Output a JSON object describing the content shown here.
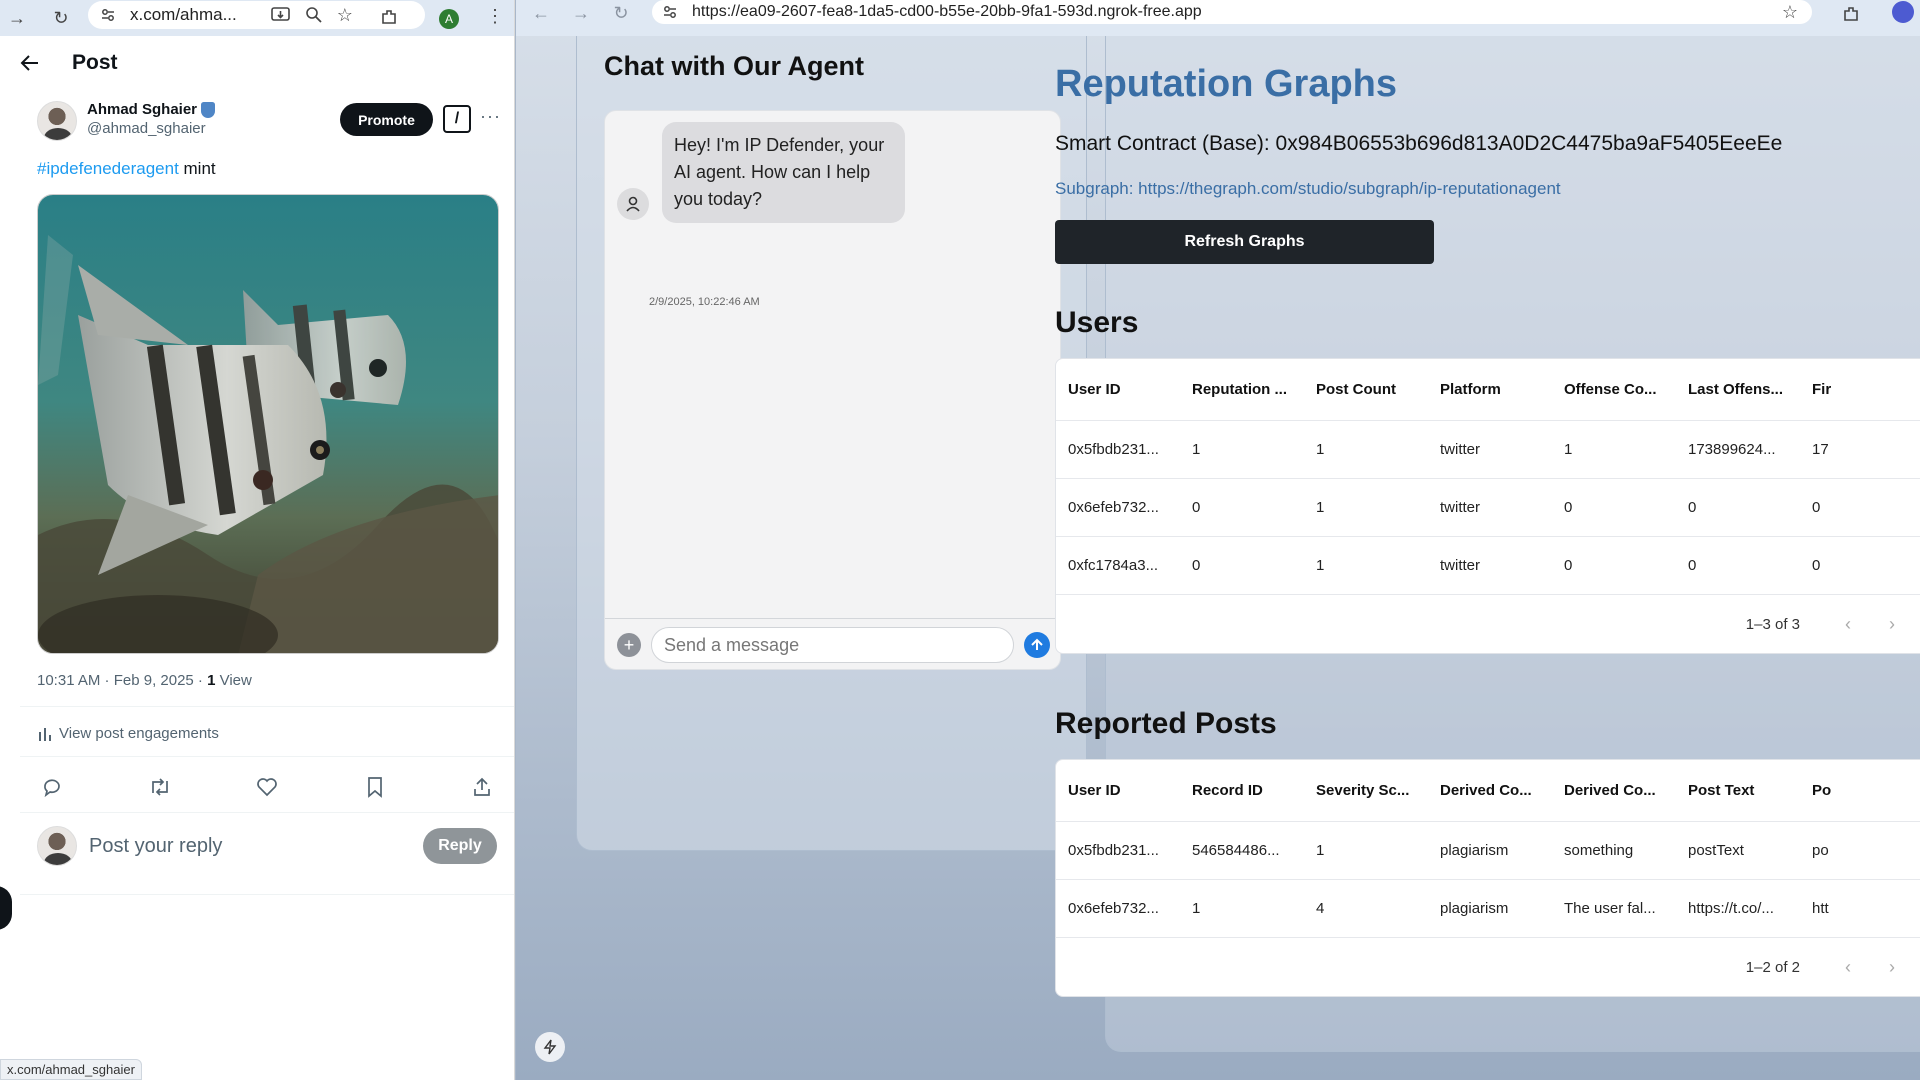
{
  "left": {
    "omnibox_url": "x.com/ahma...",
    "avatar_letter": "A",
    "header_title": "Post",
    "author_name": "Ahmad Sghaier",
    "author_handle": "@ahmad_sghaier",
    "promote_label": "Promote",
    "grok_label": "/",
    "more_label": "···",
    "post_hashtag": "#ipdefenederagent",
    "post_text": " mint",
    "meta_time": "10:31 AM · Feb 9, 2025 · ",
    "meta_views_count": "1",
    "meta_views_label": " View",
    "engagements_label": "View post engagements",
    "reply_placeholder": "Post your reply",
    "reply_label": "Reply",
    "status_url": "x.com/ahmad_sghaier"
  },
  "right": {
    "omnibox_url": "https://ea09-2607-fea8-1da5-cd00-b55e-20bb-9fa1-593d.ngrok-free.app",
    "chat": {
      "title": "Chat with Our Agent",
      "message": "Hey! I'm IP Defender, your AI agent. How can I help you today?",
      "timestamp": "2/9/2025, 10:22:46 AM",
      "input_placeholder": "Send a message"
    },
    "graphs": {
      "title": "Reputation Graphs",
      "contract": "Smart Contract (Base): 0x984B06553b696d813A0D2C4475ba9aF5405EeeEe",
      "subgraph": "Subgraph: https://thegraph.com/studio/subgraph/ip-reputationagent",
      "refresh_label": "Refresh Graphs"
    },
    "users": {
      "title": "Users",
      "columns": [
        "User ID",
        "Reputation ...",
        "Post Count",
        "Platform",
        "Offense Co...",
        "Last Offens...",
        "Fir"
      ],
      "rows": [
        [
          "0x5fbdb231...",
          "1",
          "1",
          "twitter",
          "1",
          "173899624...",
          "17"
        ],
        [
          "0x6efeb732...",
          "0",
          "1",
          "twitter",
          "0",
          "0",
          "0"
        ],
        [
          "0xfc1784a3...",
          "0",
          "1",
          "twitter",
          "0",
          "0",
          "0"
        ]
      ],
      "pagination": "1–3 of 3"
    },
    "reported": {
      "title": "Reported Posts",
      "columns": [
        "User ID",
        "Record ID",
        "Severity Sc...",
        "Derived Co...",
        "Derived Co...",
        "Post Text",
        "Po"
      ],
      "rows": [
        [
          "0x5fbdb231...",
          "546584486...",
          "1",
          "plagiarism",
          "something",
          "postText",
          "po"
        ],
        [
          "0x6efeb732...",
          "1",
          "4",
          "plagiarism",
          "The user fal...",
          "https://t.co/...",
          "htt"
        ]
      ],
      "pagination": "1–2 of 2"
    }
  }
}
